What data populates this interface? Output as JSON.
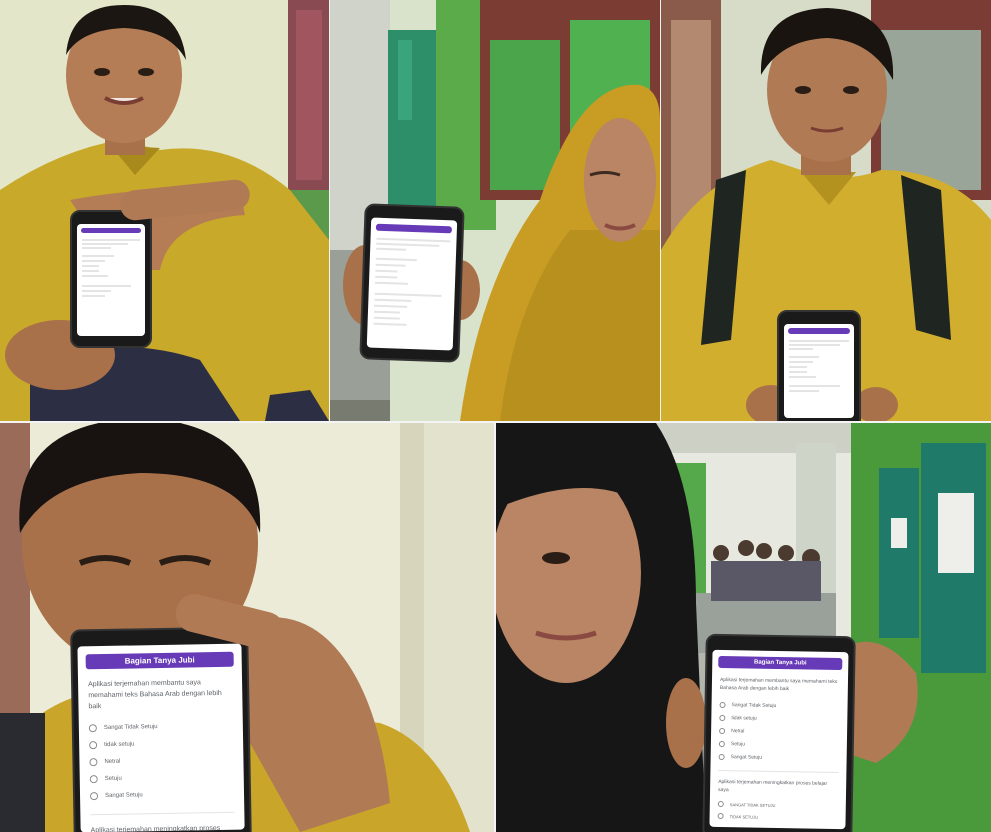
{
  "screens": {
    "large_4": {
      "header": "Bagian Tanya Jubi",
      "q1": "Aplikasi terjemahan membantu saya memahami teks Bahasa Arab dengan lebih baik",
      "options": [
        "Sangat Tidak Setuju",
        "tidak setuju",
        "Netral",
        "Setuju",
        "Sangat Setuju"
      ],
      "q2": "Aplikasi terjemahan meningkatkan proses belajar saya"
    },
    "large_5": {
      "header": "Bagian Tanya Jubi",
      "q1": "Aplikasi terjemahan membantu saya memahami teks Bahasa Arab dengan lebih baik",
      "options": [
        "Sangat Tidak Setuju",
        "tidak setuju",
        "Netral",
        "Setuju",
        "Sangat Setuju"
      ],
      "q2": "Aplikasi terjemahan meningkatkan proses belajar saya",
      "options2": [
        "SANGAT TIDAK SETUJU",
        "TIDAK SETUJU"
      ]
    }
  },
  "colors": {
    "form_header": "#673ab7",
    "yellow_shirt": "#c9a92a",
    "hijab_black": "#161616",
    "wall_green": "#4a9a3c",
    "wall_cream": "#e8e6c4"
  }
}
